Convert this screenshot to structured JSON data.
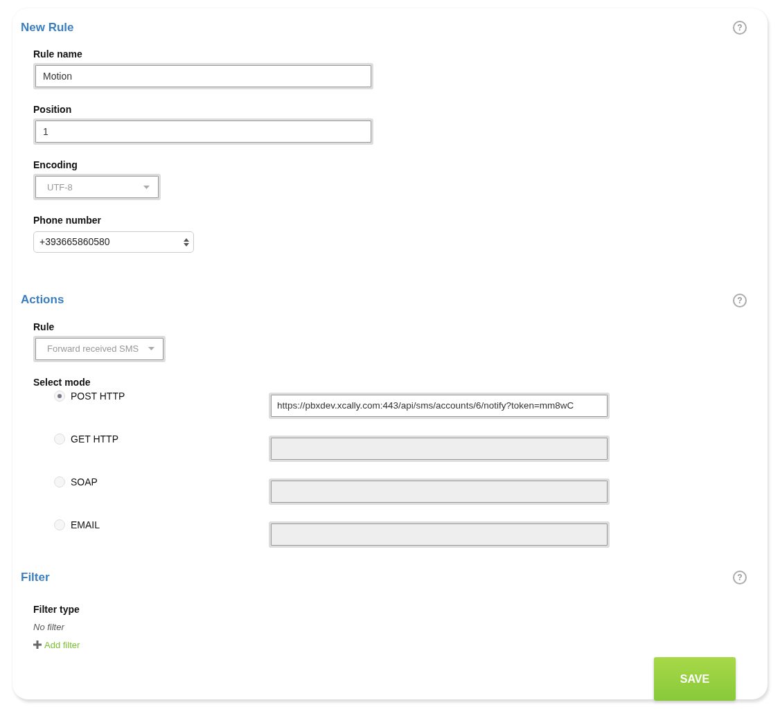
{
  "sections": [
    {
      "kind": "fields",
      "title": "New Rule",
      "help": "?",
      "fields": [
        {
          "kind": "text",
          "label": "Rule name",
          "value": "Motion"
        },
        {
          "kind": "text",
          "label": "Position",
          "value": "1"
        },
        {
          "kind": "dropdown",
          "label": "Encoding",
          "value": "UTF-8",
          "disabled": true
        },
        {
          "kind": "spinner",
          "label": "Phone number",
          "value": "+393665860580"
        }
      ]
    },
    {
      "kind": "fields",
      "title": "Actions",
      "help": "?",
      "fields": [
        {
          "kind": "dropdown",
          "label": "Rule",
          "value": "Forward received SMS",
          "disabled": true
        },
        {
          "kind": "radios",
          "label": "Select mode",
          "options": [
            {
              "label": "POST HTTP",
              "selected": true,
              "value": "https://pbxdev.xcally.com:443/api/sms/accounts/6/notify?token=mm8wC"
            },
            {
              "label": "GET HTTP",
              "selected": false
            },
            {
              "label": "SOAP",
              "selected": false
            },
            {
              "label": "EMAIL",
              "selected": false
            }
          ]
        }
      ]
    },
    {
      "kind": "filter",
      "title": "Filter",
      "help": "?",
      "label": "Filter type",
      "empty_text": "No filter",
      "add_link": "Add filter"
    }
  ],
  "save_button": "SAVE"
}
